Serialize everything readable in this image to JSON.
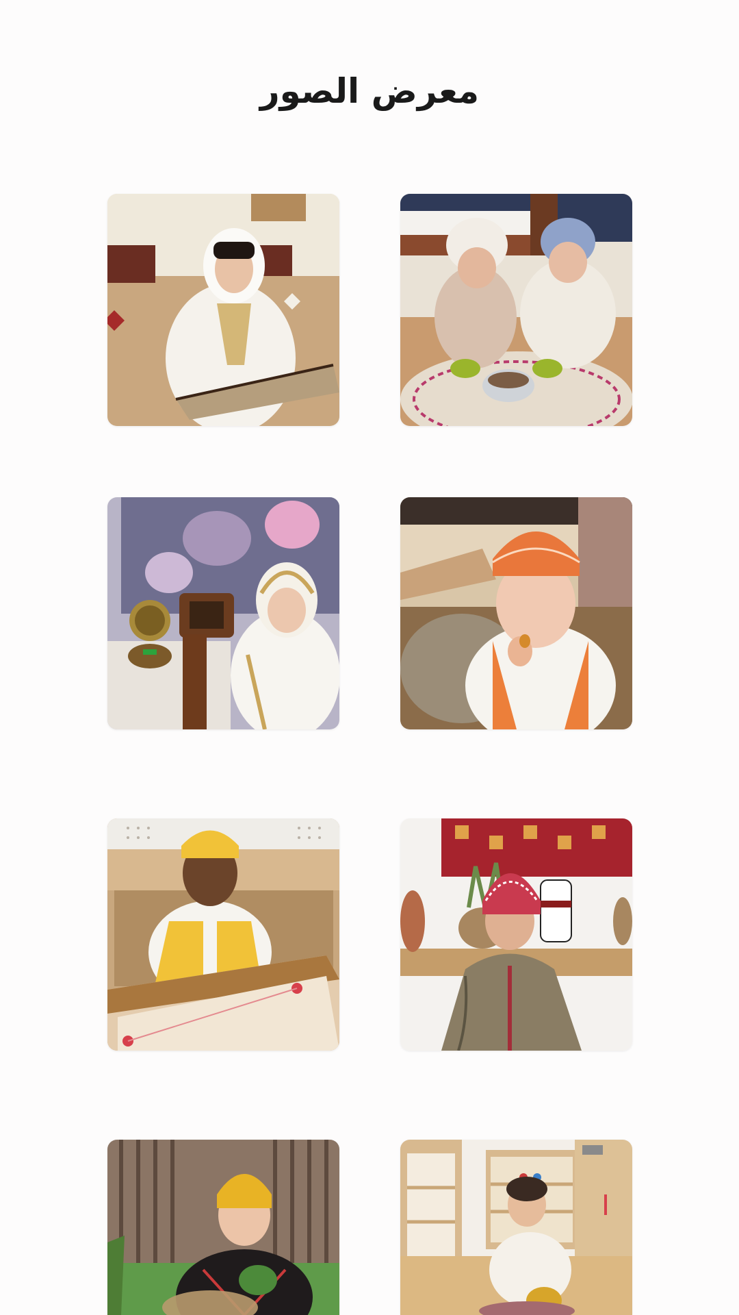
{
  "gallery": {
    "title": "معرض الصور",
    "photos": [
      {
        "icon": "photo-girl-white-veil-with-fan"
      },
      {
        "icon": "photo-two-girls-eating-on-mat"
      },
      {
        "icon": "photo-girl-with-radio"
      },
      {
        "icon": "photo-boy-orange-cap-eating"
      },
      {
        "icon": "photo-boy-yellow-vest-carrom-board"
      },
      {
        "icon": "photo-boy-red-shemagh-jacket"
      },
      {
        "icon": "photo-girl-yellow-scarf-with-plants"
      },
      {
        "icon": "photo-boy-with-teapot-in-playroom"
      }
    ]
  },
  "colors": {
    "background": "#fdfcfc",
    "title": "#1a1a1a"
  }
}
